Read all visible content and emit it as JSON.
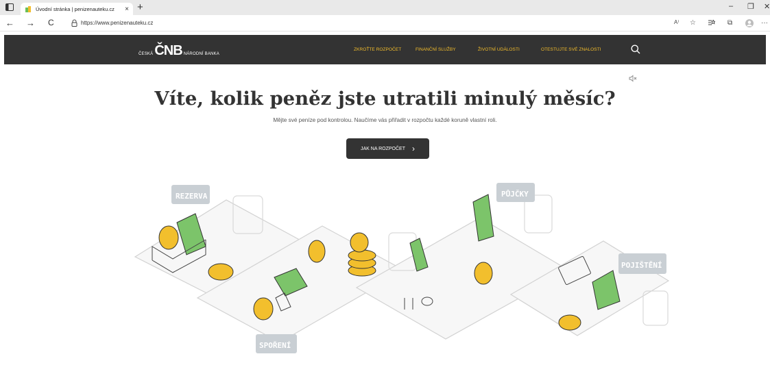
{
  "browser": {
    "tab_title": "Úvodní stránka | penizenauteku.cz",
    "tab_close": "×",
    "new_tab": "+",
    "url": "https://www.penizenauteku.cz",
    "window_controls": {
      "minimize": "–",
      "restore": "❐",
      "close": "✕"
    },
    "nav": {
      "back": "←",
      "forward": "→",
      "refresh": "C"
    },
    "toolbar": {
      "read_aloud": "A⁾",
      "favorites": "☆",
      "collections": "⧉",
      "more": "···"
    }
  },
  "site": {
    "logo": {
      "pre": "ČESKÁ",
      "mark": "ČNB",
      "post": "NÁRODNÍ BANKA"
    },
    "nav_items": [
      "ZKROŤTE ROZPOČET",
      "FINANČNÍ SLUŽBY",
      "ŽIVOTNÍ UDÁLOSTI",
      "OTESTUJTE SVÉ ZNALOSTI"
    ],
    "accent_color": "#f3bd2b"
  },
  "hero": {
    "headline": "Víte, kolik peněz jste utratili minulý měsíc?",
    "subline": "Mějte své peníze pod kontrolou. Naučíme vás přiřadit v rozpočtu každé koruně vlastní roli.",
    "cta_label": "JAK NA ROZPOČET",
    "cta_icon": "›"
  },
  "illustration": {
    "labels": {
      "reserve": "REZERVA",
      "loans": "PŮJČKY",
      "insurance": "POJIŠTĚNÍ",
      "savings": "SPOŘENÍ"
    }
  }
}
